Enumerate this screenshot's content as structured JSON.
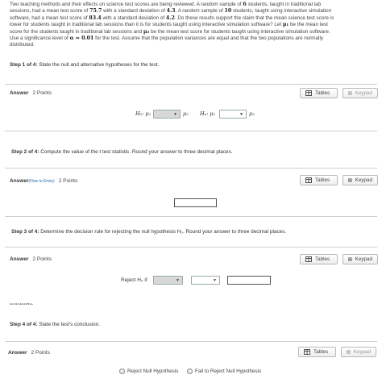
{
  "problem": {
    "line1": "Two teaching methods and their effects on science test scores are being reviewed. A random sample of",
    "n1": "6",
    "line1b": "students, taught in traditional lab",
    "line2a": "sessions, had a mean test score of",
    "mean1": "75.7",
    "line2b": "with a standard deviation of",
    "sd1": "4.3",
    "line2c": ". A random sample of",
    "n2": "10",
    "line2d": "students, taught using interactive simulation",
    "line3a": "software, had a mean test score of",
    "mean2": "83.4",
    "line3b": "with a standard deviation of",
    "sd2": "4.2",
    "line3c": ". Do these results support the claim that the mean science test score is",
    "line4a": "lower for students taught in traditional lab sessions than it is for students taught using interactive simulation software? Let",
    "mu1": "μ₁",
    "line4b": "be the mean test",
    "line5a": "score for the students taught in traditional lab sessions and",
    "mu2": "μ₂",
    "line5b": "be the mean test score for students taught using interactive simulation software.",
    "line6a": "Use a significance level of",
    "alpha": "α = 0.01",
    "line6b": "for the test. Assume that the population variances are equal and that the two populations are normally",
    "line7": "distributed."
  },
  "steps": [
    {
      "num": "Step 1 of 4:",
      "text": "State the null and alternative hypotheses for the test."
    },
    {
      "num": "Step 2 of 4:",
      "text": "Compute the value of the t test statistic. Round your answer to three decimal places."
    },
    {
      "num": "Step 3 of 4:",
      "text": "Determine the decision rule for rejecting the null hypothesis H₀. Round your answer to three decimal places."
    },
    {
      "num": "Step 4 of 4:",
      "text": "State the test's conclusion."
    }
  ],
  "answers": [
    {
      "label": "Answer",
      "points": "2 Points",
      "hint": ""
    },
    {
      "label": "Answer",
      "points": "2 Points",
      "hint": "(How to Enter)"
    },
    {
      "label": "Answer",
      "points": "2 Points",
      "hint": ""
    },
    {
      "label": "Answer",
      "points": "2 Points",
      "hint": ""
    }
  ],
  "buttons": {
    "tables": "Tables",
    "keypad": "Keypad"
  },
  "hypotheses": {
    "h0": "H₀: μ₁",
    "h0_rhs": "μ₂",
    "ha": "Hₐ: μ₁",
    "ha_rhs": "μ₂"
  },
  "decision": {
    "reject": "Reject H₀ if"
  },
  "fragment": "distributed.",
  "conclusion": {
    "reject": "Reject Null Hypothesis",
    "fail": "Fail to Reject Null Hypothesis"
  }
}
